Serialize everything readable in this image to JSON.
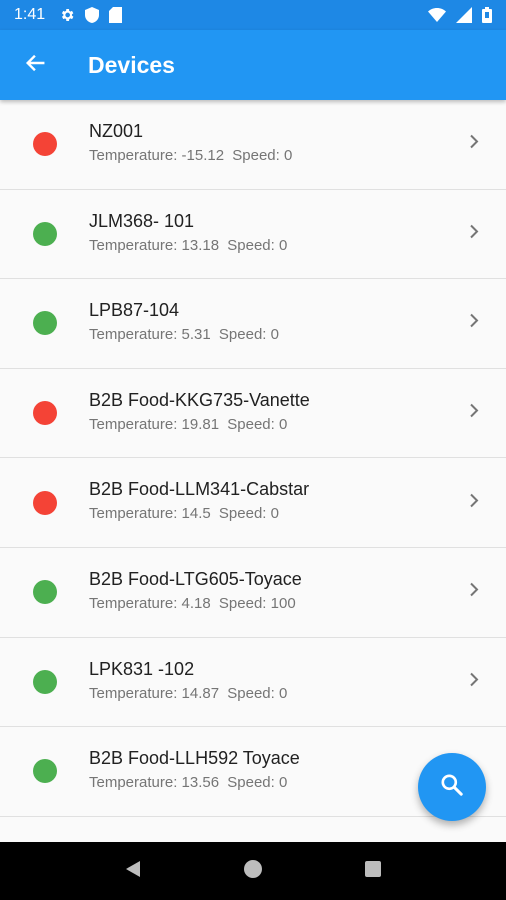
{
  "status_bar": {
    "time": "1:41",
    "icons_left": [
      "settings-icon",
      "shield-icon",
      "sd-card-icon"
    ],
    "icons_right": [
      "wifi-icon",
      "signal-icon",
      "battery-icon"
    ]
  },
  "app_bar": {
    "title": "Devices",
    "back_icon": "arrow-back-icon",
    "color": "#2196f3"
  },
  "colors": {
    "online": "#4caf50",
    "offline": "#f44336",
    "accent": "#2196f3"
  },
  "devices": [
    {
      "name": "NZ001",
      "status": "offline",
      "temperature_label": "Temperature: -15.12",
      "speed_label": "Speed: 0"
    },
    {
      "name": "JLM368- 101",
      "status": "online",
      "temperature_label": "Temperature: 13.18",
      "speed_label": "Speed: 0"
    },
    {
      "name": "LPB87-104",
      "status": "online",
      "temperature_label": "Temperature: 5.31",
      "speed_label": "Speed: 0"
    },
    {
      "name": "B2B Food-KKG735-Vanette",
      "status": "offline",
      "temperature_label": "Temperature: 19.81",
      "speed_label": "Speed: 0"
    },
    {
      "name": "B2B Food-LLM341-Cabstar",
      "status": "offline",
      "temperature_label": "Temperature: 14.5",
      "speed_label": "Speed: 0"
    },
    {
      "name": "B2B Food-LTG605-Toyace",
      "status": "online",
      "temperature_label": "Temperature: 4.18",
      "speed_label": "Speed: 100"
    },
    {
      "name": "LPK831 -102",
      "status": "online",
      "temperature_label": "Temperature: 14.87",
      "speed_label": "Speed: 0"
    },
    {
      "name": "B2B Food-LLH592 Toyace",
      "status": "online",
      "temperature_label": "Temperature: 13.56",
      "speed_label": "Speed: 0"
    }
  ],
  "fab": {
    "icon": "search-icon"
  },
  "nav_bar": {
    "icons": [
      "back-triangle-icon",
      "home-circle-icon",
      "recents-square-icon"
    ]
  }
}
